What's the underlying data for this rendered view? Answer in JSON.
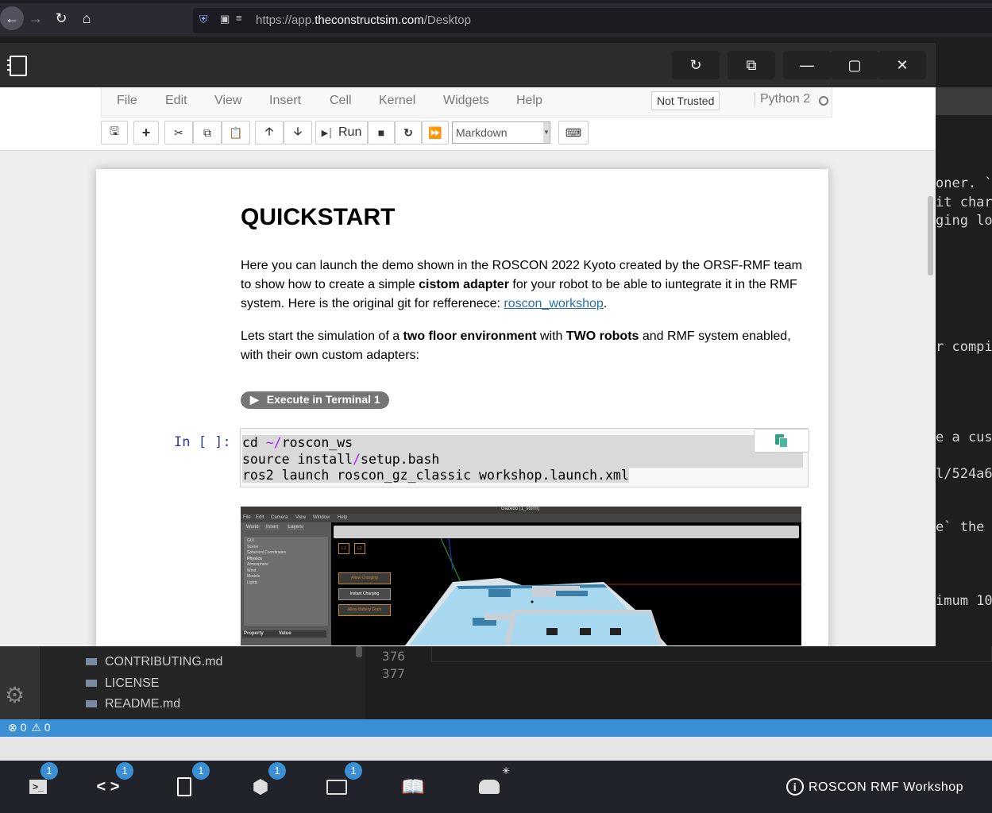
{
  "browser": {
    "url_prefix": "https://app.",
    "url_domain": "theconstructsim.com",
    "url_path": "/Desktop"
  },
  "menu": {
    "items": [
      "File",
      "Edit",
      "View",
      "Insert",
      "Cell",
      "Kernel",
      "Widgets",
      "Help"
    ],
    "trust_status": "Not Trusted",
    "kernel": "Python 2"
  },
  "toolbar": {
    "run_label": "Run",
    "cell_type": "Markdown"
  },
  "notebook": {
    "title": "QUICKSTART",
    "p1_a": "Here you can launch the demo shown in the ROSCON 2022 Kyoto created by the ORSF-RMF team to show how to create a simple ",
    "p1_b": "cistom adapter",
    "p1_c": " for your robot to be able to iuntegrate it in the RMF system. Here is the original git for refferenece: ",
    "p1_link": "roscon_workshop",
    "p1_d": ".",
    "p2_a": "Lets start the simulation of a ",
    "p2_b": "two floor environment",
    "p2_c": " with ",
    "p2_d": "TWO robots",
    "p2_e": " and RMF system enabled, with their own custom adapters:",
    "exec_button": "Execute in Terminal 1",
    "prompt": "In [ ]:",
    "code_l1_a": "cd ",
    "code_l1_op": "~/",
    "code_l1_b": "roscon_ws",
    "code_l2_a": "source install",
    "code_l2_op": "/",
    "code_l2_b": "setup.bash",
    "code_l3": "ros2 launch roscon_gz_classic workshop.launch.xml"
  },
  "gazebo": {
    "title": "Gazebo (1_storm)",
    "menu": [
      "File",
      "Edit",
      "Camera",
      "View",
      "Window",
      "Help"
    ],
    "tabs": [
      "World",
      "Insert",
      "Layers"
    ],
    "tree": [
      "GUI",
      "Scene",
      "Spherical Coordinates",
      "Physics",
      "Atmosphere",
      "Wind",
      "Models",
      "Lights"
    ],
    "prop_header": [
      "Property",
      "Value"
    ],
    "buttons": [
      "Allow Charging",
      "Instant Charging",
      "Allow Battery Drain"
    ],
    "level_buttons": [
      "L1",
      "L2"
    ]
  },
  "background_code": [
    "oner. `C",
    "it charg",
    "ging loc",
    "r compil",
    "e a cus",
    "l/524a6",
    "e` the",
    "imum 10"
  ],
  "ide": {
    "files": [
      "CONTRIBUTING.md",
      "LICENSE",
      "README.md"
    ],
    "line_numbers": [
      "376",
      "377"
    ],
    "errors": "0",
    "warnings": "0"
  },
  "dock": {
    "badges": [
      "1",
      "1",
      "1",
      "1",
      "1"
    ],
    "title": "ROSCON RMF Workshop"
  },
  "colors": {
    "status_blue": "#3b8fd4",
    "link_blue": "#296eaa",
    "prompt_blue": "#303f9f",
    "dock_bg": "#20232a"
  }
}
